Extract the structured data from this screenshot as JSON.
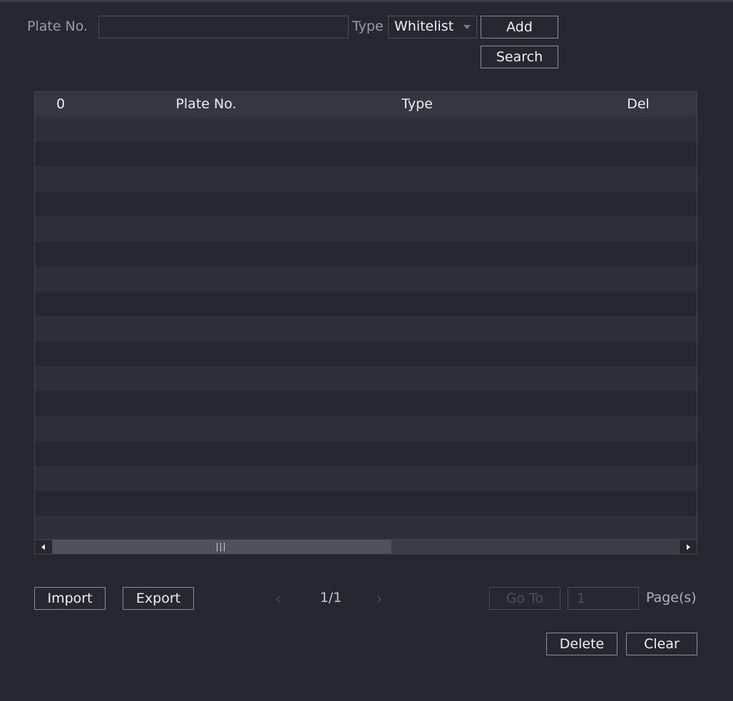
{
  "filter": {
    "plate_label": "Plate No.",
    "plate_value": "",
    "type_label": "Type",
    "type_selected": "Whitelist",
    "add_label": "Add",
    "search_label": "Search"
  },
  "table": {
    "columns": [
      "0",
      "Plate No.",
      "Type",
      "Del"
    ],
    "rows": []
  },
  "footer": {
    "import_label": "Import",
    "export_label": "Export",
    "prev_icon": "chevron-left-icon",
    "next_icon": "chevron-right-icon",
    "page_indicator": "1/1",
    "goto_label": "Go To",
    "goto_value": "1",
    "pages_label": "Page(s)",
    "delete_label": "Delete",
    "clear_label": "Clear"
  },
  "colors": {
    "background": "#262730",
    "header": "#353641",
    "row_alt": "#2e2f39",
    "border": "#8c8d97"
  }
}
